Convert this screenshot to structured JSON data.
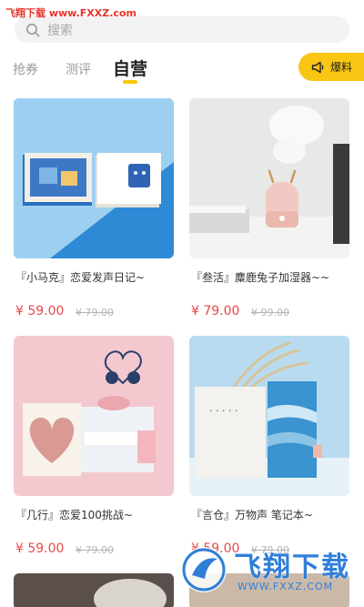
{
  "watermark_top": "飞翔下载 www.FXXZ.com",
  "search": {
    "placeholder": "搜索",
    "icon": "search-icon"
  },
  "tabs": [
    {
      "label": "抢券"
    },
    {
      "label": "测评"
    },
    {
      "label": "自营",
      "active": true
    }
  ],
  "baoliao": {
    "label": "爆料",
    "icon": "megaphone-icon"
  },
  "colors": {
    "accent": "#f9c614",
    "price": "#e8474a"
  },
  "products": [
    {
      "title": "『小马克』恋爱发声日记~",
      "price": "¥ 59.00",
      "original_price": "¥ 79.00"
    },
    {
      "title": "『叁活』麋鹿兔子加湿器~~",
      "price": "¥ 79.00",
      "original_price": "¥ 99.00"
    },
    {
      "title": "『几行』恋爱100挑战~",
      "price": "¥ 59.00",
      "original_price": "¥ 79.00"
    },
    {
      "title": "『言仓』万物声 笔记本~",
      "price": "¥ 59.00",
      "original_price": "¥ 79.00"
    }
  ],
  "logo_watermark": {
    "big": "飞翔下载",
    "small": "WWW.FXXZ.COM"
  }
}
